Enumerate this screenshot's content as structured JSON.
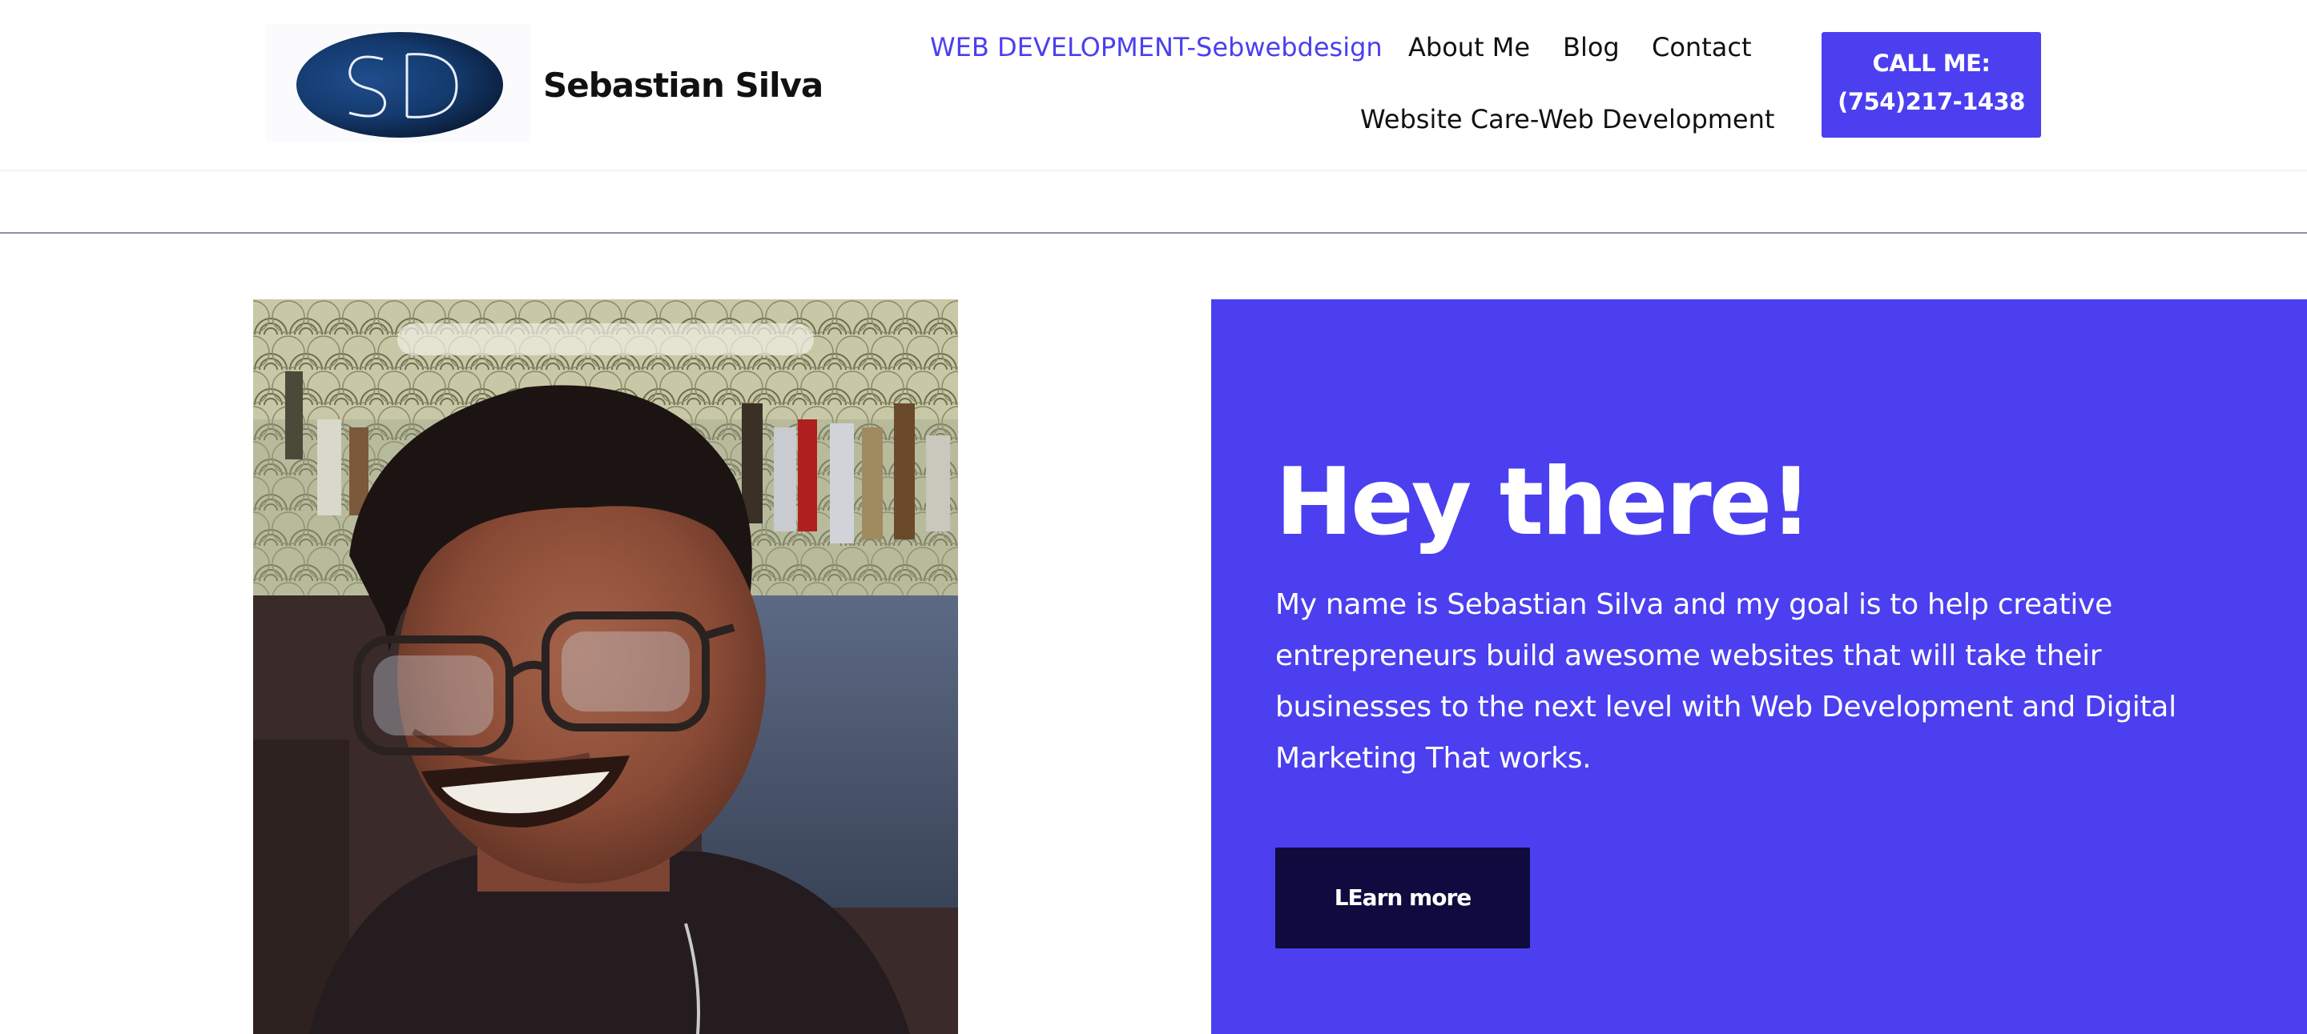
{
  "header": {
    "logo_letters": "SD",
    "brand_name": "Sebastian Silva",
    "nav": [
      {
        "label": "WEB DEVELOPMENT-Sebwebdesign",
        "active": true
      },
      {
        "label": "About Me"
      },
      {
        "label": "Blog"
      },
      {
        "label": "Contact"
      },
      {
        "label": "Website Care-Web Development"
      }
    ],
    "call_button": {
      "line1": "CALL ME:",
      "line2": "(754)217-1438"
    }
  },
  "hero": {
    "title": "Hey there!",
    "text": "My name is Sebastian Silva and my goal is to help creative entrepreneurs build awesome websites that will take their businesses to the next level with Web Development and Digital Marketing That works.",
    "button_label": "LEarn more"
  },
  "colors": {
    "accent": "#4b3ff0",
    "dark_button": "#0f0b3e",
    "logo_navy": "#143a6e"
  }
}
